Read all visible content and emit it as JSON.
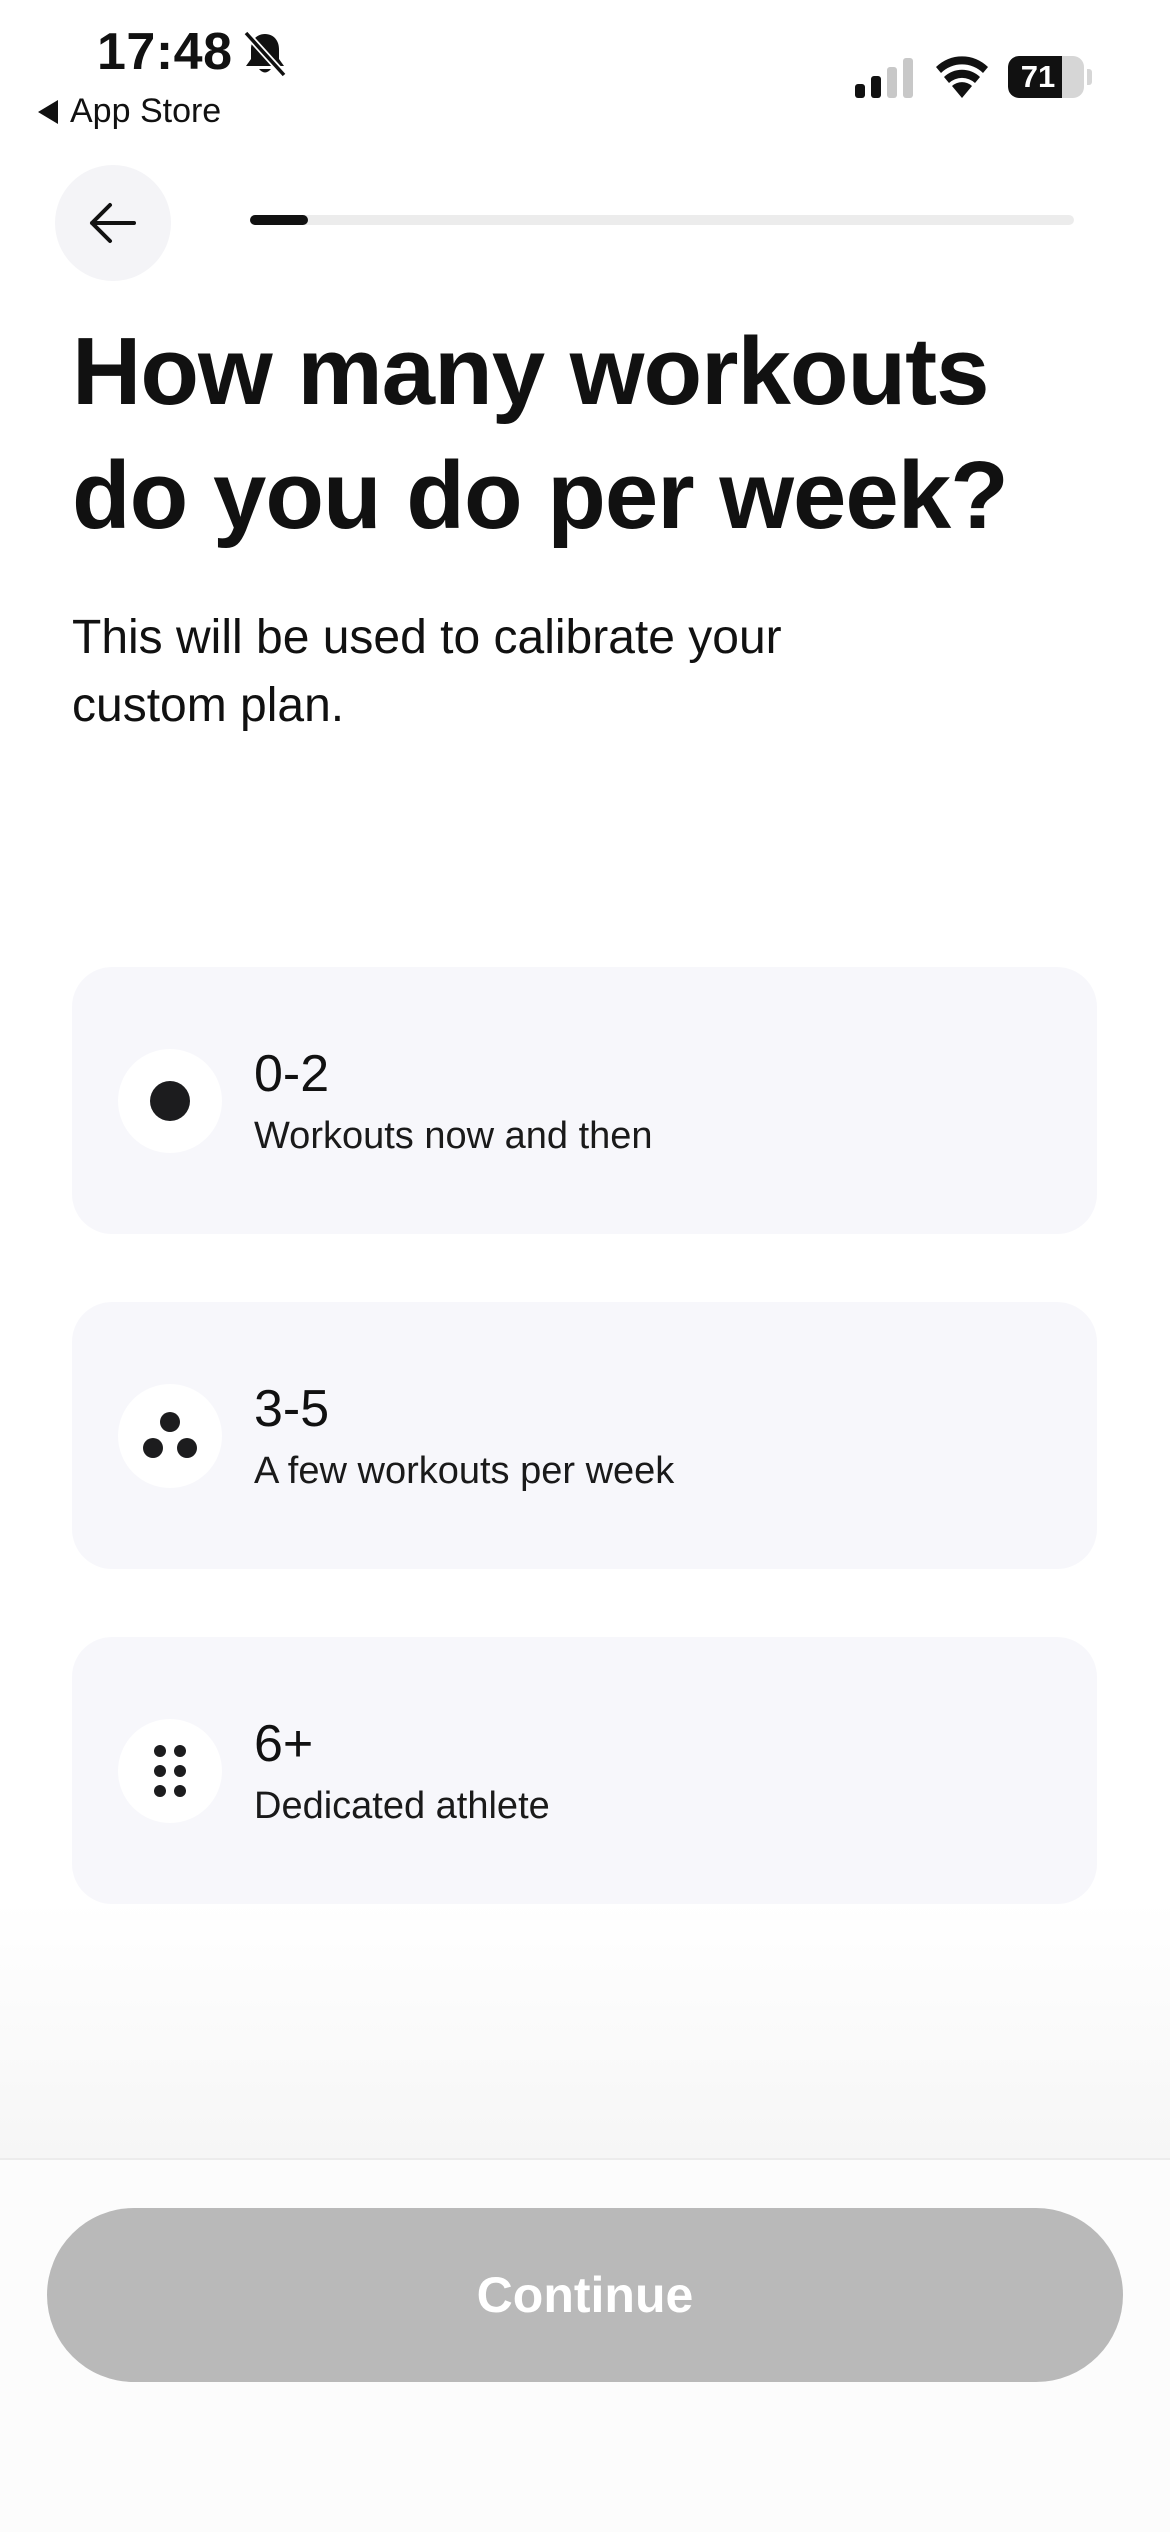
{
  "status_bar": {
    "time": "17:48",
    "back_app": "App Store",
    "battery": "71",
    "battery_level": 0.71,
    "icons": [
      "bell-slash-icon",
      "signal-icon",
      "wifi-icon",
      "battery-icon"
    ]
  },
  "header": {
    "back_icon": "arrow-left-icon",
    "progress": 0.07
  },
  "question": {
    "title": "How many workouts do you do per week?",
    "subtitle": "This will be used to calibrate your custom plan."
  },
  "options": [
    {
      "label": "0-2",
      "description": "Workouts now and then",
      "icon": "one-dot-icon"
    },
    {
      "label": "3-5",
      "description": "A few workouts per week",
      "icon": "three-dots-icon"
    },
    {
      "label": "6+",
      "description": "Dedicated athlete",
      "icon": "six-dots-icon"
    }
  ],
  "footer": {
    "continue_label": "Continue",
    "continue_color": "#b9b9b9"
  }
}
